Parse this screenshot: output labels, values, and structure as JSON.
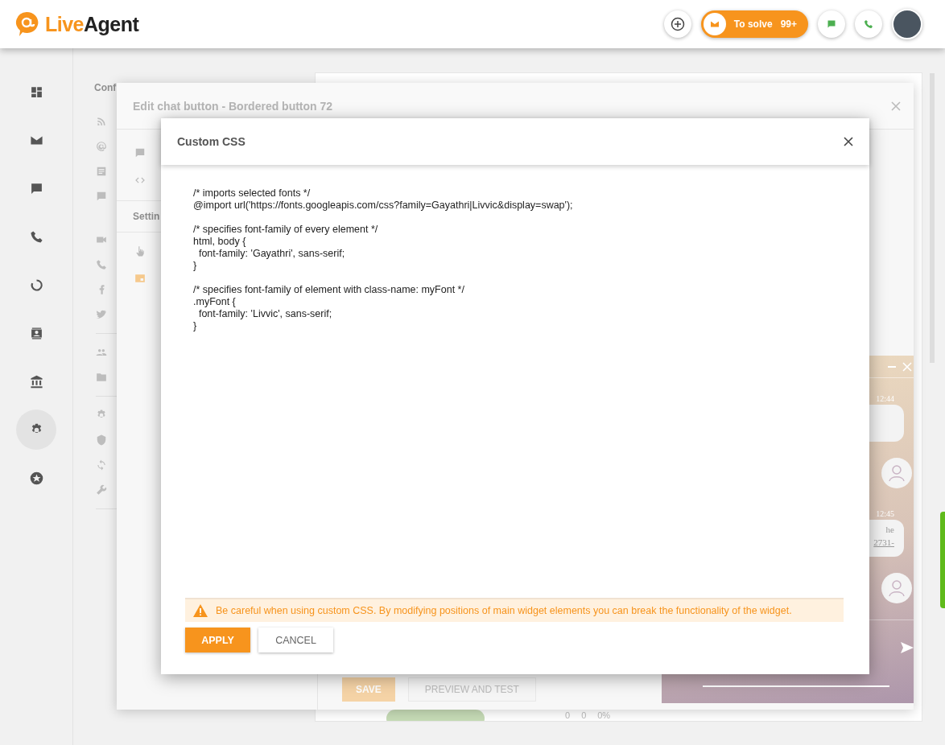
{
  "topbar": {
    "logo": {
      "part_1": "Live",
      "part_2": "Agent"
    },
    "to_solve": {
      "label": "To solve",
      "count": "99+"
    }
  },
  "nav": {
    "items": [
      {
        "kind": "dashboard",
        "selected": false
      },
      {
        "kind": "mail",
        "selected": false
      },
      {
        "kind": "chat",
        "selected": false
      },
      {
        "kind": "phone",
        "selected": false
      },
      {
        "kind": "donut",
        "selected": false
      },
      {
        "kind": "contacts",
        "selected": false
      },
      {
        "kind": "bank",
        "selected": false
      },
      {
        "kind": "gear",
        "selected": true
      },
      {
        "kind": "star",
        "selected": false
      }
    ]
  },
  "sidebar": {
    "title": "Conf",
    "groups": [
      [
        {
          "kind": "rss"
        },
        {
          "kind": "at"
        },
        {
          "kind": "doc"
        },
        {
          "kind": "chat"
        },
        {
          "kind": "blank"
        },
        {
          "kind": "video"
        },
        {
          "kind": "phone"
        },
        {
          "kind": "facebook"
        },
        {
          "kind": "twitter"
        }
      ],
      [
        {
          "kind": "people"
        },
        {
          "kind": "folder"
        }
      ],
      [
        {
          "kind": "gear"
        },
        {
          "kind": "shield"
        },
        {
          "kind": "sync"
        },
        {
          "kind": "wrench"
        }
      ]
    ]
  },
  "main": {
    "stats": [
      "0",
      "0",
      "0%"
    ]
  },
  "edit_dialog": {
    "title": "Edit chat button - Bordered button 72",
    "menu": [
      {
        "kind": "chat"
      },
      {
        "kind": "code"
      }
    ],
    "settings_heading": "Settin",
    "settings_menu": [
      {
        "kind": "hand"
      },
      {
        "kind": "widget"
      }
    ],
    "save": "SAVE",
    "preview": "PREVIEW AND TEST",
    "chat_preview": {
      "messages": [
        {
          "time": "12:44"
        },
        {
          "time": "12:45",
          "lines": [
            "he",
            "2731-"
          ]
        }
      ]
    }
  },
  "css_dialog": {
    "title": "Custom CSS",
    "code_blocks": [
      [
        "/* imports selected fonts */",
        "@import url('https://fonts.googleapis.com/css?family=Gayathri|Livvic&display=swap');"
      ],
      [
        "/* specifies font-family of every element */",
        "html, body {",
        "  font-family: 'Gayathri', sans-serif;",
        "}"
      ],
      [
        "/* specifies font-family of element with class-name: myFont */",
        ".myFont {",
        "  font-family: 'Livvic', sans-serif;",
        "}"
      ]
    ],
    "warning": "Be careful when using custom CSS. By modifying positions of main widget elements you can break the functionality of the widget.",
    "apply": "APPLY",
    "cancel": "CANCEL"
  }
}
